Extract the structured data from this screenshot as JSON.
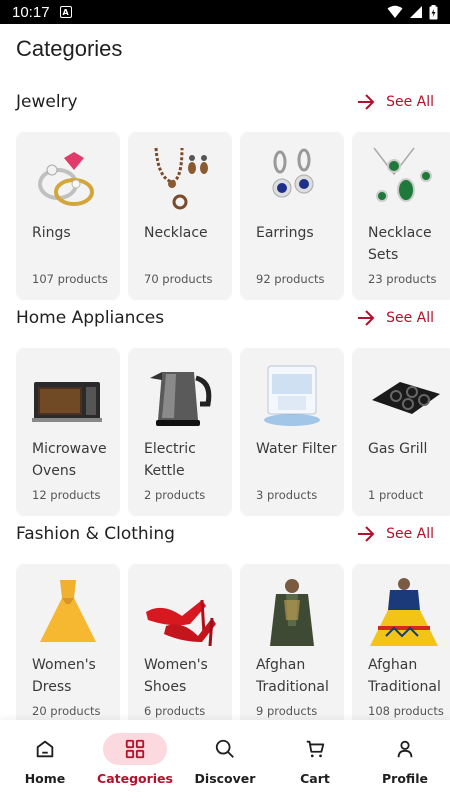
{
  "status_bar": {
    "time": "10:17"
  },
  "page_title": "Categories",
  "colors": {
    "accent": "#b0132b",
    "card_bg": "#f3f3f3",
    "active_pill": "#fbd9df"
  },
  "sections": [
    {
      "title": "Jewelry",
      "see_all": "See All",
      "items": [
        {
          "name": "Rings",
          "count": "107 products",
          "icon": "rings-image"
        },
        {
          "name": "Necklace",
          "count": "70 products",
          "icon": "necklace-image"
        },
        {
          "name": "Earrings",
          "count": "92 products",
          "icon": "earrings-image"
        },
        {
          "name": "Necklace Sets",
          "count": "23 products",
          "icon": "necklace-set-image"
        }
      ]
    },
    {
      "title": "Home Appliances",
      "see_all": "See All",
      "items": [
        {
          "name": "Microwave Ovens",
          "count": "12 products",
          "icon": "microwave-image"
        },
        {
          "name": "Electric Kettle",
          "count": "2 products",
          "icon": "kettle-image"
        },
        {
          "name": "Water Filter",
          "count": "3 products",
          "icon": "water-filter-image"
        },
        {
          "name": "Gas Grill",
          "count": "1 product",
          "icon": "gas-grill-image"
        }
      ]
    },
    {
      "title": "Fashion & Clothing",
      "see_all": "See All",
      "items": [
        {
          "name": "Women's Dress",
          "count": "20 products",
          "icon": "dress-image"
        },
        {
          "name": "Women's Shoes",
          "count": "6 products",
          "icon": "shoes-image"
        },
        {
          "name": "Afghan Traditional",
          "count": "9 products",
          "icon": "afghan-men-image"
        },
        {
          "name": "Afghan Traditional",
          "count": "108 products",
          "icon": "afghan-women-image"
        }
      ]
    }
  ],
  "bottom_nav": [
    {
      "label": "Home",
      "icon": "home-icon",
      "active": false
    },
    {
      "label": "Categories",
      "icon": "grid-icon",
      "active": true
    },
    {
      "label": "Discover",
      "icon": "search-icon",
      "active": false
    },
    {
      "label": "Cart",
      "icon": "cart-icon",
      "active": false
    },
    {
      "label": "Profile",
      "icon": "profile-icon",
      "active": false
    }
  ]
}
